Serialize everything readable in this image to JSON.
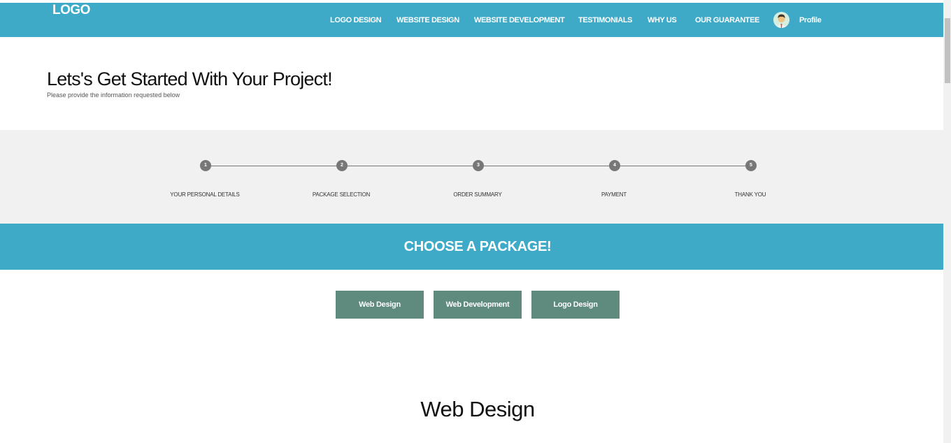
{
  "header": {
    "logo": "LOGO",
    "nav": [
      "LOGO DESIGN",
      "WEBSITE DESIGN",
      "WEBSITE DEVELOPMENT",
      "TESTIMONIALS",
      "WHY US",
      "OUR GUARANTEE"
    ],
    "profile_label": "Profile",
    "accent_color": "#3eaac7"
  },
  "hero": {
    "title": "Lets's Get Started With Your Project!",
    "subtitle": "Please provide the information requested below"
  },
  "steps": [
    {
      "number": "1",
      "label": "YOUR PERSONAL DETAILS"
    },
    {
      "number": "2",
      "label": "PACKAGE SELECTION"
    },
    {
      "number": "3",
      "label": "ORDER SUMMARY"
    },
    {
      "number": "4",
      "label": "PAYMENT"
    },
    {
      "number": "5",
      "label": "THANK YOU"
    }
  ],
  "packages": {
    "heading": "CHOOSE A PACKAGE!",
    "buttons": [
      "Web Design",
      "Web Development",
      "Logo Design"
    ],
    "button_color": "#5f8a7e"
  },
  "section": {
    "title": "Web Design"
  }
}
